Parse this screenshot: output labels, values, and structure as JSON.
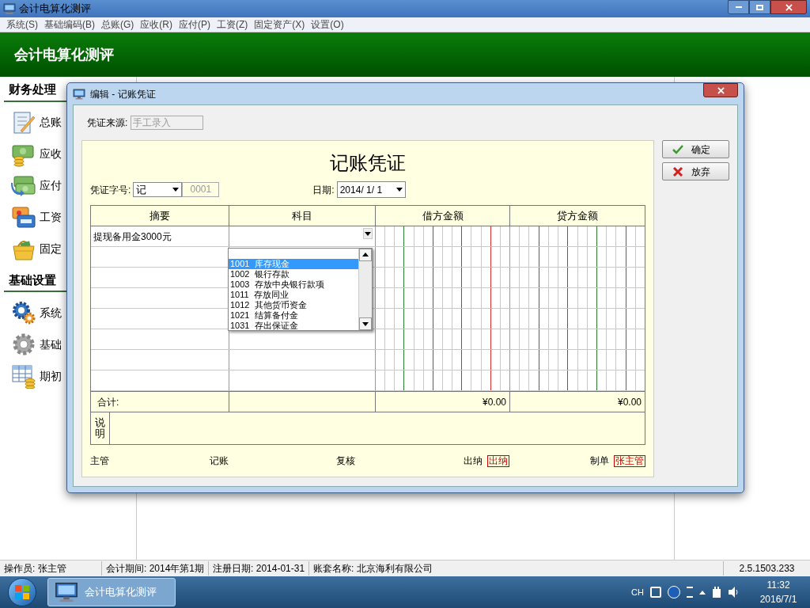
{
  "window": {
    "title": "会计电算化测评"
  },
  "menu": [
    "系统(S)",
    "基础编码(B)",
    "总账(G)",
    "应收(R)",
    "应付(P)",
    "工资(Z)",
    "固定资产(X)",
    "设置(O)"
  ],
  "header": {
    "title": "会计电算化测评"
  },
  "sidebar": {
    "sections": [
      {
        "title": "财务处理",
        "items": [
          "总账",
          "应收",
          "应付",
          "工资",
          "固定"
        ]
      },
      {
        "title": "基础设置",
        "items": [
          "系统",
          "基础",
          "期初"
        ]
      }
    ]
  },
  "dialog": {
    "title": "编辑 - 记账凭证",
    "source": {
      "label": "凭证来源:",
      "value": "手工录入",
      "disabled": true
    },
    "voucher": {
      "title": "记账凭证",
      "type_label": "凭证字号:",
      "type_value": "记",
      "number": {
        "value": "0001",
        "disabled": true
      },
      "date_label": "日期:",
      "date_value": "2014/ 1/ 1",
      "columns": [
        "摘要",
        "科目",
        "借方金额",
        "贷方金额"
      ],
      "rows": [
        {
          "summary": "提现备用金3000元"
        }
      ],
      "totals": {
        "label": "合计:",
        "debit": "¥0.00",
        "credit": "¥0.00"
      },
      "note_label": "说明",
      "signatures": [
        {
          "label": "主管"
        },
        {
          "label": "记账"
        },
        {
          "label": "复核"
        },
        {
          "label": "出纳",
          "stamp": "出纳"
        },
        {
          "label": "制单",
          "stamp": "张主管"
        }
      ]
    },
    "account_dropdown": {
      "items": [
        {
          "label": "1001  库存现金",
          "selected": true
        },
        {
          "label": "1002  银行存款",
          "selected": false
        },
        {
          "label": "1003  存放中央银行款项",
          "selected": false
        },
        {
          "label": "1011  存放同业",
          "selected": false
        },
        {
          "label": "1012  其他货币资金",
          "selected": false
        },
        {
          "label": "1021  结算备付金",
          "selected": false
        },
        {
          "label": "1031  存出保证金",
          "selected": false
        }
      ]
    },
    "buttons": [
      {
        "label": "确定",
        "kind": "ok"
      },
      {
        "label": "放弃",
        "kind": "cancel"
      }
    ]
  },
  "status_bar": [
    "操作员: 张主管",
    "会计期间: 2014年第1期",
    "注册日期: 2014-01-31",
    "账套名称: 北京海利有限公司",
    "2.5.1503.233"
  ],
  "taskbar": {
    "app": "会计电算化测评",
    "lang": "CH",
    "time": "11:32",
    "date": "2016/7/1"
  }
}
